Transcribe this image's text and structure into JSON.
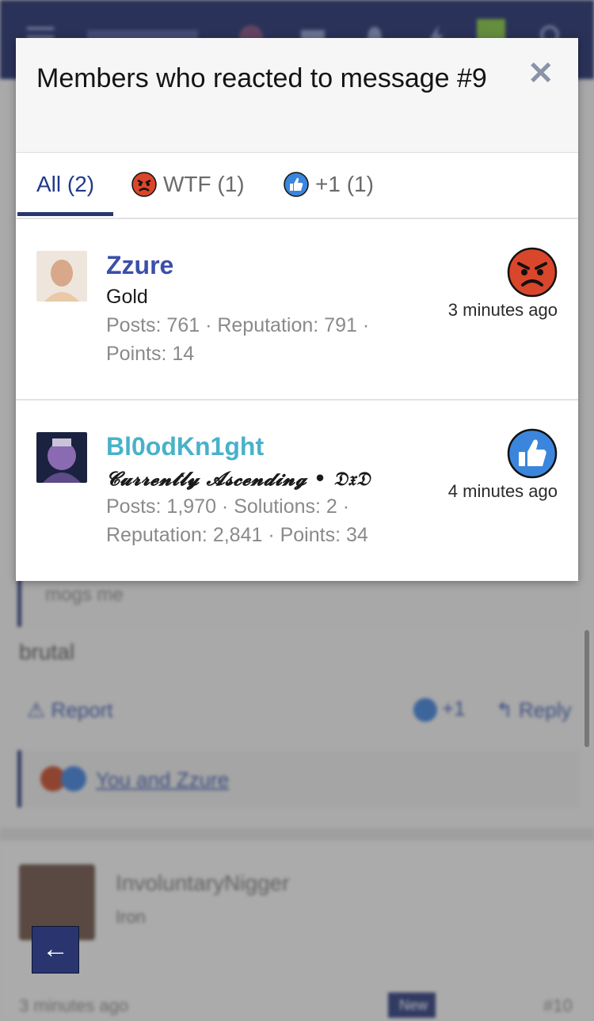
{
  "background": {
    "quote_text": "mogs me",
    "post_text": "brutal",
    "report_label": "Report",
    "plus_label": "+1",
    "reply_label": "Reply",
    "reactions_summary": "You and Zzure",
    "next_post": {
      "name": "InvoluntaryNigger",
      "role": "Iron",
      "time": "3 minutes ago",
      "badge": "New",
      "number": "#10"
    }
  },
  "modal": {
    "title": "Members who reacted to message #9",
    "close_glyph": "✕",
    "tabs": [
      {
        "label": "All (2)",
        "active": true
      },
      {
        "label": "WTF (1)",
        "icon": "angry-face-icon"
      },
      {
        "label": "+1 (1)",
        "icon": "thumbs-up-icon"
      }
    ],
    "reactors": [
      {
        "name": "Zzure",
        "name_color": "#3b4fa8",
        "title": "Gold",
        "stats": "Posts: 761 · Reputation: 791 · Points: 14",
        "reaction": "angry-face-icon",
        "time": "3 minutes ago"
      },
      {
        "name": "Bl0odKn1ght",
        "name_color": "#48b2c9",
        "title": "𝓒𝓾𝓻𝓻𝓮𝓷𝓽𝓵𝔂 𝓐𝓼𝓬𝓮𝓷𝓭𝓲𝓷𝓰 • 𝔇𝔵𝔇",
        "stats": "Posts: 1,970 · Solutions: 2 · Reputation: 2,841 · Points: 34",
        "reaction": "thumbs-up-icon",
        "time": "4 minutes ago"
      }
    ]
  },
  "back_button_glyph": "←",
  "colors": {
    "header_navy": "#1f2d6b",
    "angry_red": "#d9462b",
    "like_blue": "#3b86dc"
  }
}
